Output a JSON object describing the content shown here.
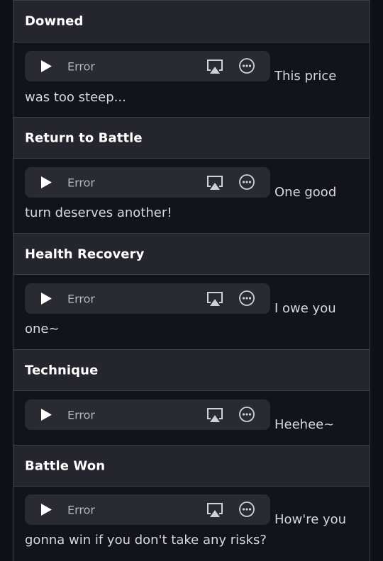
{
  "voice_lines": [
    {
      "title": "Downed",
      "player_status": "Error",
      "quote_line1": "This price",
      "quote_line2": "was too steep..."
    },
    {
      "title": "Return to Battle",
      "player_status": "Error",
      "quote_line1": "One good",
      "quote_line2": "turn deserves another!"
    },
    {
      "title": "Health Recovery",
      "player_status": "Error",
      "quote_line1": "I owe you",
      "quote_line2": "one~"
    },
    {
      "title": "Technique",
      "player_status": "Error",
      "quote_line1": "Heehee~",
      "quote_line2": ""
    },
    {
      "title": "Battle Won",
      "player_status": "Error",
      "quote_line1": "How're you",
      "quote_line2": "gonna win if you don't take any risks?"
    }
  ],
  "icons": {
    "play": "play-icon",
    "airplay": "airplay-icon",
    "more": "more-options-icon"
  },
  "colors": {
    "background": "#101018",
    "header_background": "#24252d",
    "player_background": "#2a2b32",
    "text": "#d8d9de",
    "title": "#ffffff"
  }
}
